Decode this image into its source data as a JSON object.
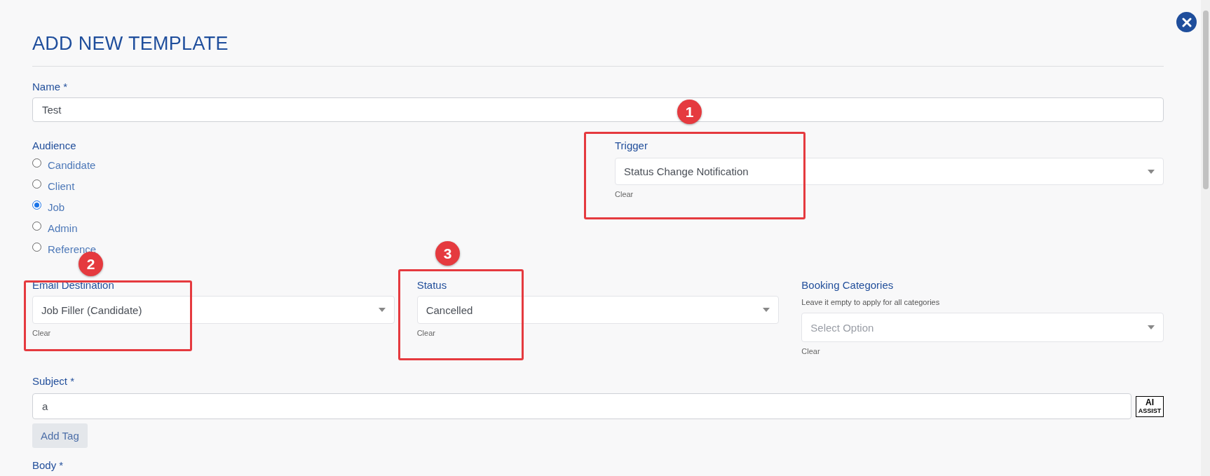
{
  "title": "ADD NEW TEMPLATE",
  "name_field": {
    "label": "Name *",
    "value": "Test"
  },
  "audience": {
    "label": "Audience",
    "options": [
      {
        "label": "Candidate",
        "selected": false
      },
      {
        "label": "Client",
        "selected": false
      },
      {
        "label": "Job",
        "selected": true
      },
      {
        "label": "Admin",
        "selected": false
      },
      {
        "label": "Reference",
        "selected": false
      }
    ]
  },
  "trigger": {
    "label": "Trigger",
    "value": "Status Change Notification",
    "clear": "Clear"
  },
  "email_destination": {
    "label": "Email Destination",
    "value": "Job Filler (Candidate)",
    "clear": "Clear"
  },
  "status": {
    "label": "Status",
    "value": "Cancelled",
    "clear": "Clear"
  },
  "booking_categories": {
    "label": "Booking Categories",
    "hint": "Leave it empty to apply for all categories",
    "placeholder": "Select Option",
    "clear": "Clear"
  },
  "subject": {
    "label": "Subject *",
    "value": "a",
    "ai_badge": {
      "top": "AI",
      "bottom": "ASSIST"
    },
    "add_tag": "Add Tag"
  },
  "body": {
    "label": "Body *"
  },
  "annotations": [
    {
      "number": "1"
    },
    {
      "number": "2"
    },
    {
      "number": "3"
    }
  ]
}
